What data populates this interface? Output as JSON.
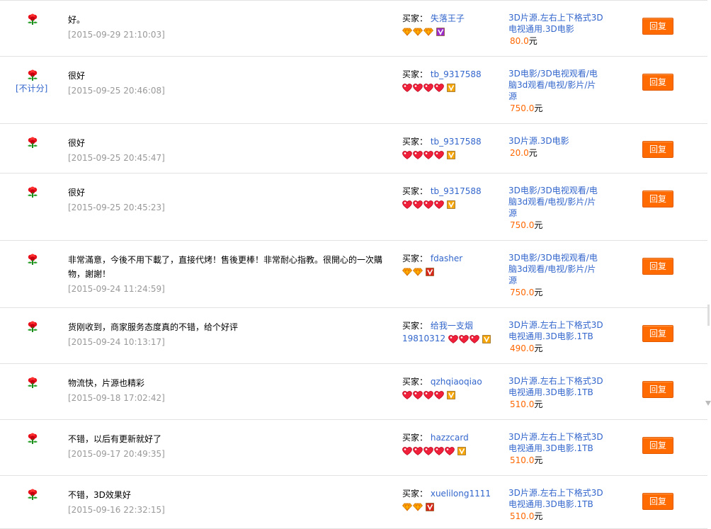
{
  "reply_label": "回复",
  "buyer_label": "买家：",
  "currency_unit": "元",
  "no_count_label": "[不计分]",
  "colors": {
    "accent": "#ff6600",
    "link": "#3366cc",
    "date": "#999999",
    "button": "#ff6b00"
  },
  "rows": [
    {
      "comment": "好。",
      "date": "[2015-09-29 21:10:03]",
      "buyer": "失落王子",
      "badge": "diamond",
      "badge_count": 3,
      "vip": "purple",
      "product": "3D片源.左右上下格式3D电视通用.3D电影",
      "price": "80.0",
      "no_count": false
    },
    {
      "comment": "很好",
      "date": "[2015-09-25 20:46:08]",
      "buyer": "tb_9317588",
      "badge": "heart",
      "badge_count": 4,
      "vip": "gold",
      "product": "3D电影/3D电视观看/电脑3d观看/电视/影片/片源",
      "price": "750.0",
      "no_count": true
    },
    {
      "comment": "很好",
      "date": "[2015-09-25 20:45:47]",
      "buyer": "tb_9317588",
      "badge": "heart",
      "badge_count": 4,
      "vip": "gold",
      "product": "3D片源.3D电影",
      "price": "20.0",
      "no_count": false
    },
    {
      "comment": "很好",
      "date": "[2015-09-25 20:45:23]",
      "buyer": "tb_9317588",
      "badge": "heart",
      "badge_count": 4,
      "vip": "gold",
      "product": "3D电影/3D电视观看/电脑3d观看/电视/影片/片源",
      "price": "750.0",
      "no_count": false
    },
    {
      "comment": "非常滿意，今後不用下載了，直接代烤！售後更棒！非常耐心指教。很開心的一次購物，謝謝！",
      "date": "[2015-09-24 11:24:59]",
      "buyer": "fdasher",
      "badge": "diamond",
      "badge_count": 2,
      "vip": "red",
      "product": "3D电影/3D电视观看/电脑3d观看/电视/影片/片源",
      "price": "750.0",
      "no_count": false
    },
    {
      "comment": "货刚收到，商家服务态度真的不错，给个好评",
      "date": "[2015-09-24 10:13:17]",
      "buyer": "给我一支烟19810312",
      "badge": "heart",
      "badge_count": 3,
      "vip": "gold",
      "product": "3D片源.左右上下格式3D电视通用.3D电影.1TB",
      "price": "490.0",
      "no_count": false
    },
    {
      "comment": "物流快，片源也精彩",
      "date": "[2015-09-18 17:02:42]",
      "buyer": "qzhqiaoqiao",
      "badge": "heart",
      "badge_count": 4,
      "vip": "gold",
      "product": "3D片源.左右上下格式3D电视通用.3D电影.1TB",
      "price": "510.0",
      "no_count": false
    },
    {
      "comment": "不错，以后有更新就好了",
      "date": "[2015-09-17 20:49:35]",
      "buyer": "hazzcard",
      "badge": "heart",
      "badge_count": 5,
      "vip": "gold",
      "product": "3D片源.左右上下格式3D电视通用.3D电影.1TB",
      "price": "510.0",
      "no_count": false
    },
    {
      "comment": "不错，3D效果好",
      "date": "[2015-09-16 22:32:15]",
      "buyer": "xuelilong1111",
      "badge": "diamond",
      "badge_count": 2,
      "vip": "red",
      "product": "3D片源.左右上下格式3D电视通用.3D电影.1TB",
      "price": "510.0",
      "no_count": false
    }
  ]
}
